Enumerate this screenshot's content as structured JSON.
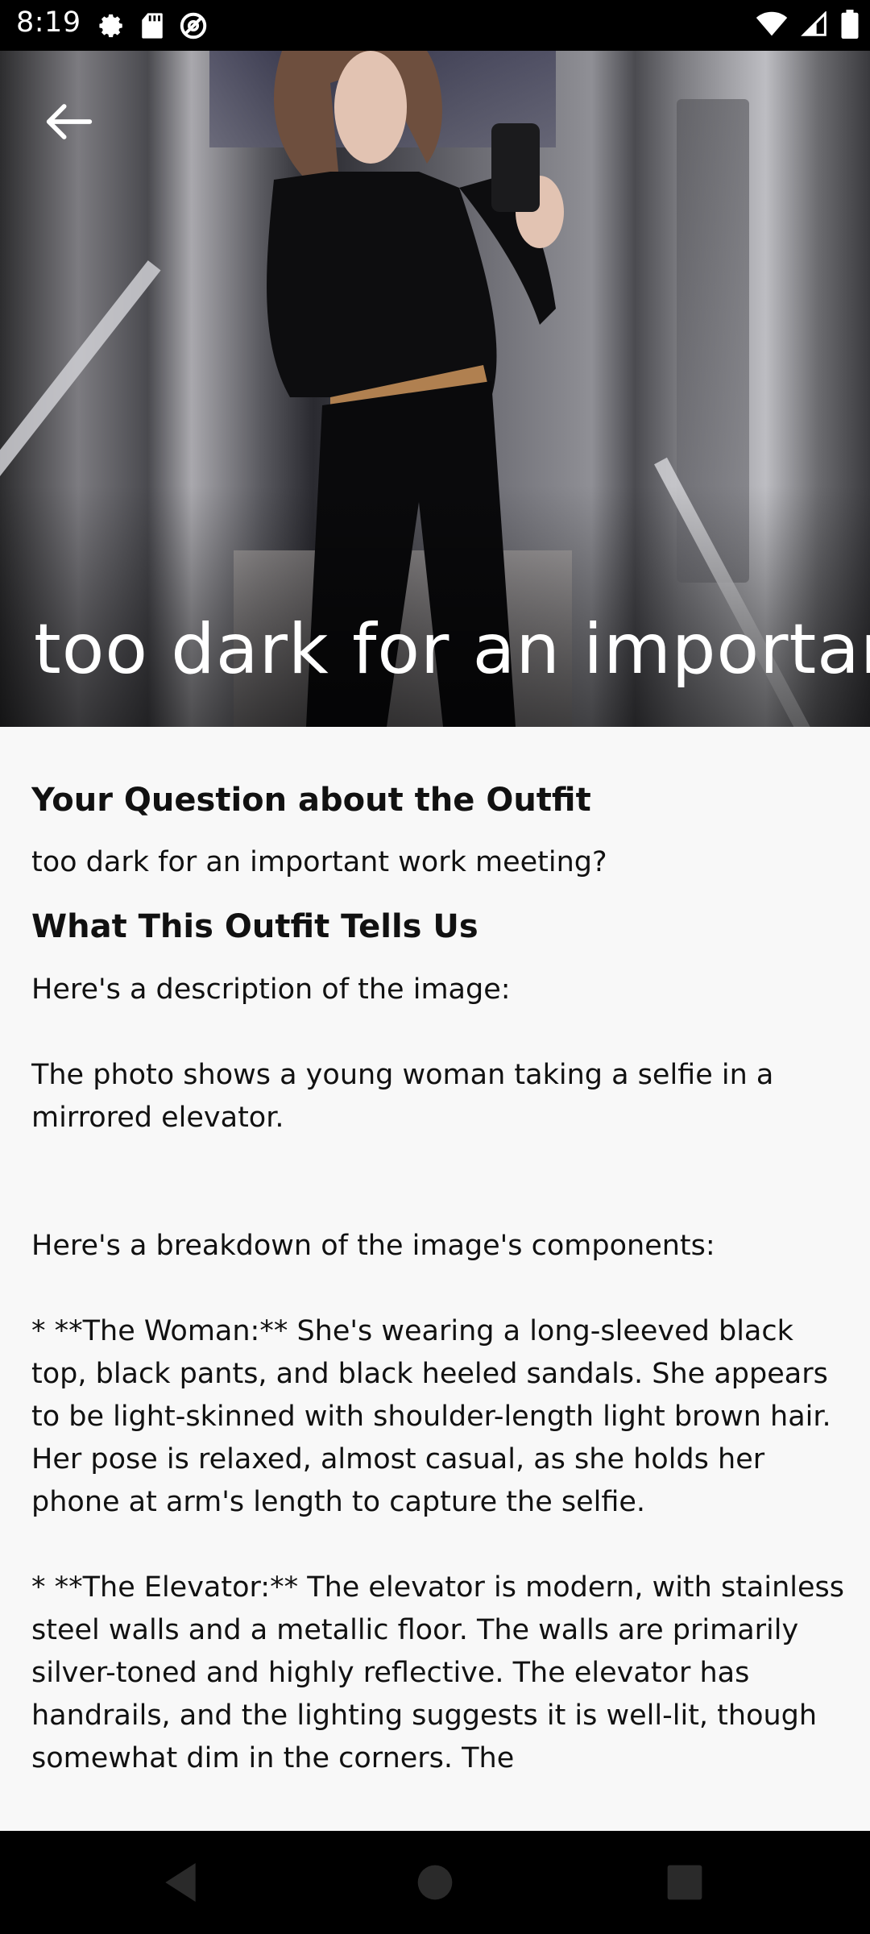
{
  "status_bar": {
    "time": "8:19",
    "left_icons": [
      "settings-icon",
      "sd-card-icon",
      "at-sign-icon"
    ],
    "right_icons": [
      "wifi-icon",
      "signal-icon",
      "battery-icon"
    ]
  },
  "hero": {
    "title": "too dark for an important work meeting?",
    "back_icon": "back-arrow-icon"
  },
  "content": {
    "question_heading": "Your Question about the Outfit",
    "question_text": "too dark for an important work meeting?",
    "analysis_heading": "What This Outfit Tells Us",
    "analysis_text": "Here's a description of the image:\n\nThe photo shows a young woman taking a selfie in a mirrored elevator.\n\n\nHere's a breakdown of the image's components:\n\n* **The Woman:** She's wearing a long-sleeved black top, black pants, and black heeled sandals. She appears to be light-skinned with shoulder-length light brown hair. Her pose is relaxed, almost casual, as she holds her phone at arm's length to capture the selfie.\n\n* **The Elevator:** The elevator is modern, with stainless steel walls and a metallic floor. The walls are primarily silver-toned and highly reflective. The elevator has handrails, and the lighting suggests it is well-lit, though somewhat dim in the corners. The"
  },
  "nav_bar": {
    "back": "nav-back-icon",
    "home": "nav-home-icon",
    "recents": "nav-recents-icon"
  }
}
